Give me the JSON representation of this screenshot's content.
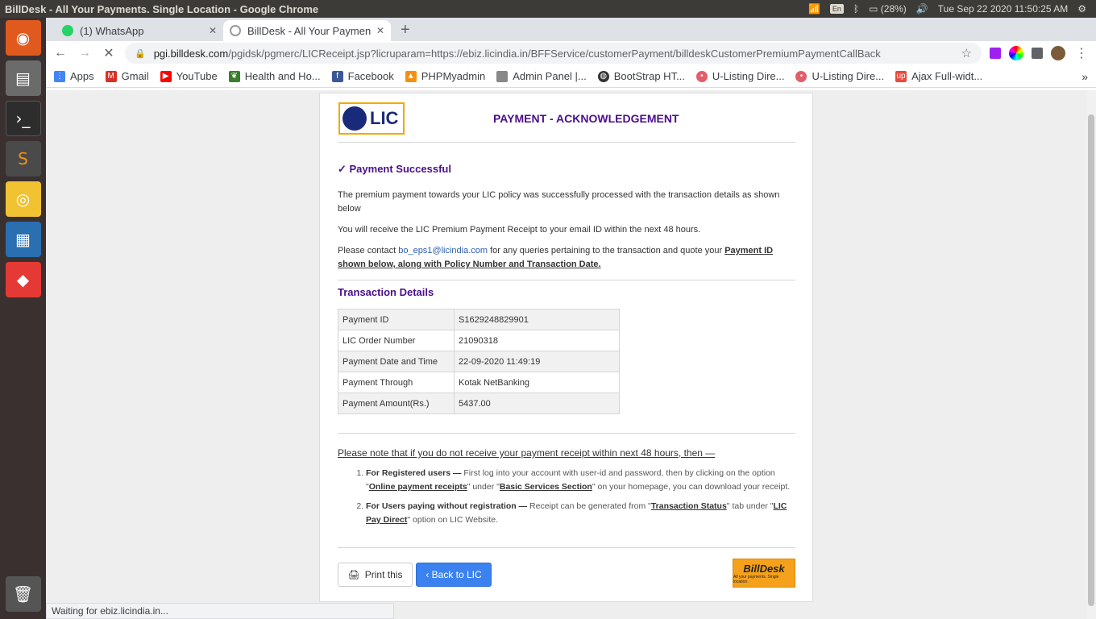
{
  "window": {
    "title": "BillDesk - All Your Payments. Single Location - Google Chrome"
  },
  "tray": {
    "lang": "En",
    "battery": "(28%)",
    "datetime": "Tue Sep 22 2020 11:50:25 AM"
  },
  "tabs": [
    {
      "label": "(1) WhatsApp",
      "favicon_color": "#25d366"
    },
    {
      "label": "BillDesk - All Your Paymen",
      "favicon_color": "#bbbbbb"
    }
  ],
  "omnibox": {
    "host": "pgi.billdesk.com",
    "path": "/pgidsk/pgmerc/LICReceipt.jsp?licruparam=https://ebiz.licindia.in/BFFService/customerPayment/billdeskCustomerPremiumPaymentCallBack"
  },
  "bookmarks": [
    {
      "label": "Apps",
      "color": "#4285f4"
    },
    {
      "label": "Gmail",
      "color": "#d93025"
    },
    {
      "label": "YouTube",
      "color": "#ff0000"
    },
    {
      "label": "Health and Ho...",
      "color": "#3a7d2c"
    },
    {
      "label": "Facebook",
      "color": "#3b5998"
    },
    {
      "label": "PHPMyadmin",
      "color": "#f29111"
    },
    {
      "label": "Admin Panel |...",
      "color": "#888888"
    },
    {
      "label": "BootStrap HT...",
      "color": "#333333"
    },
    {
      "label": "U-Listing Dire...",
      "color": "#e35d6a"
    },
    {
      "label": "U-Listing Dire...",
      "color": "#e35d6a"
    },
    {
      "label": "Ajax Full-widt...",
      "color": "#e84b3c"
    }
  ],
  "page": {
    "logo_text": "LIC",
    "title": "PAYMENT - ACKNOWLEDGEMENT",
    "success": "✓ Payment Successful",
    "para1": "The premium payment towards your LIC policy was successfully processed with the transaction details as shown below",
    "para2": "You will receive the LIC Premium Payment Receipt to your email ID within the next 48 hours.",
    "para3_pre": "Please contact ",
    "para3_email": "bo_eps1@licindia.com",
    "para3_mid": " for any queries pertaining to the transaction and quote your ",
    "para3_bold": "Payment ID shown below, along with Policy Number and Transaction Date.",
    "tx_title": "Transaction Details",
    "transactions": [
      {
        "key": "Payment ID",
        "value": "S1629248829901"
      },
      {
        "key": "LIC Order Number",
        "value": "21090318"
      },
      {
        "key": "Payment Date and Time",
        "value": "22-09-2020 11:49:19"
      },
      {
        "key": "Payment Through",
        "value": "Kotak NetBanking"
      },
      {
        "key": "Payment Amount(Rs.)",
        "value": "5437.00"
      }
    ],
    "note_title": "Please note that if you do not receive your payment receipt within next 48 hours, then —",
    "note1_head": "For Registered users —",
    "note1_a": " First log into your account with user-id and password, then by clicking on the option \"",
    "note1_link1": "Online payment receipts",
    "note1_b": "\" under \"",
    "note1_link2": "Basic Services Section",
    "note1_c": "\" on your homepage, you can download your receipt.",
    "note2_head": "For Users paying without registration —",
    "note2_a": " Receipt can be generated from \"",
    "note2_link1": "Transaction Status",
    "note2_b": "\" tab under \"",
    "note2_link2": "LIC Pay Direct",
    "note2_c": "\" option on LIC Website.",
    "print_label": "Print this",
    "back_label": "‹ Back to LIC",
    "billdesk_name": "BillDesk",
    "billdesk_tag": "All your payments. Single location."
  },
  "status": "Waiting for ebiz.licindia.in..."
}
